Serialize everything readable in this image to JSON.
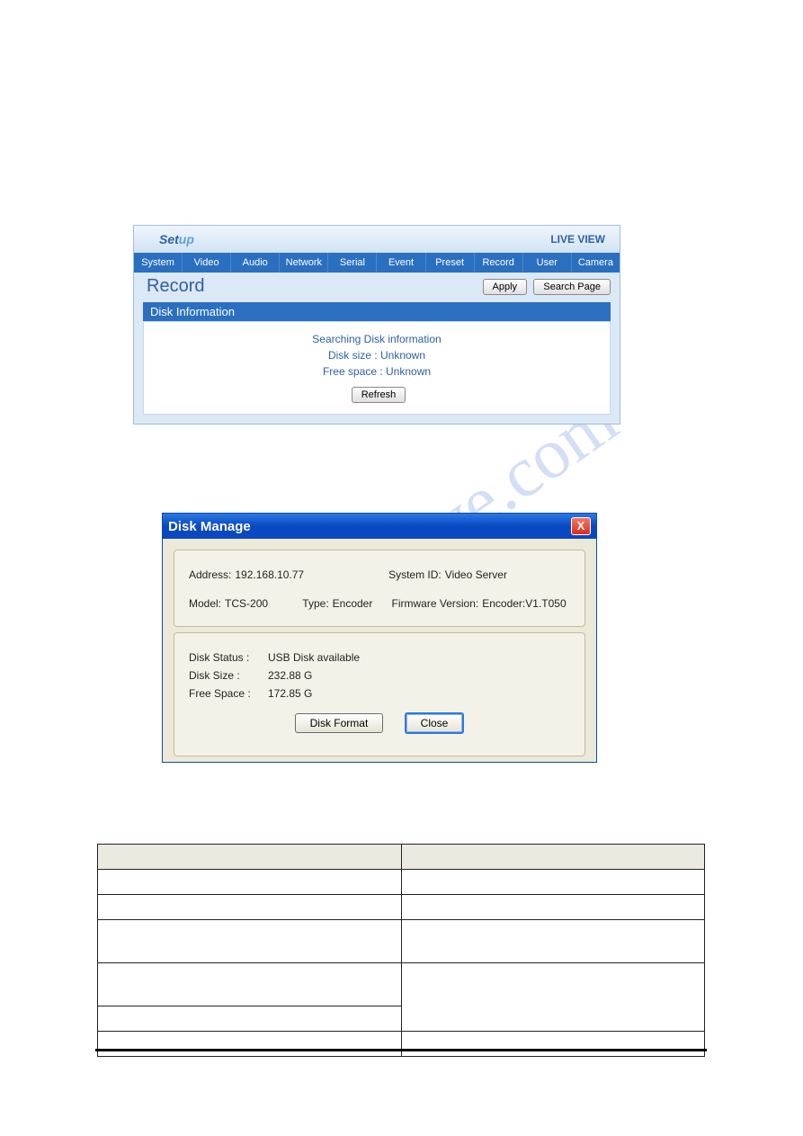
{
  "watermark": "manualshive.com",
  "web": {
    "setup_prefix": "Set",
    "setup_suffix": "up",
    "live_view": "LIVE VIEW",
    "tabs": [
      "System",
      "Video",
      "Audio",
      "Network",
      "Serial",
      "Event",
      "Preset",
      "Record",
      "User",
      "Camera"
    ],
    "page_title": "Record",
    "apply_btn": "Apply",
    "search_btn": "Search Page",
    "section_title": "Disk Information",
    "info_line1": "Searching Disk information",
    "info_line2": "Disk size : Unknown",
    "info_line3": "Free space : Unknown",
    "refresh_btn": "Refresh"
  },
  "dialog": {
    "title": "Disk Manage",
    "close_x": "X",
    "address_label": "Address:",
    "address_value": "192.168.10.77",
    "system_id_label": "System ID:",
    "system_id_value": "Video Server",
    "model_label": "Model:",
    "model_value": "TCS-200",
    "type_label": "Type:",
    "type_value": "Encoder",
    "fw_label": "Firmware Version:",
    "fw_value": "Encoder:V1.T050",
    "disk_status_label": "Disk Status :",
    "disk_status_value": "USB Disk available",
    "disk_size_label": "Disk Size :",
    "disk_size_value": "232.88 G",
    "free_space_label": "Free Space :",
    "free_space_value": "172.85 G",
    "format_btn": "Disk Format",
    "close_btn": "Close"
  }
}
